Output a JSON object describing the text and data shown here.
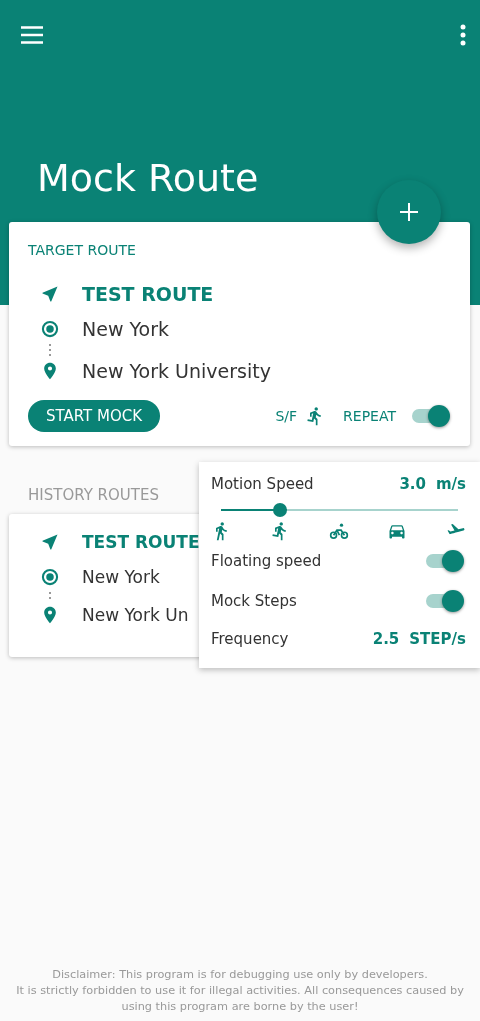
{
  "toolbar": {
    "title": "Mock Route"
  },
  "target_route": {
    "heading": "TARGET ROUTE",
    "name": "TEST ROUTE",
    "start": "New York",
    "destination": "New York University",
    "start_button": "START MOCK",
    "sf_label": "S/F",
    "repeat_label": "REPEAT",
    "repeat_on": true
  },
  "history": {
    "heading": "HISTORY ROUTES",
    "routes": [
      {
        "name": "TEST ROUTE",
        "start": "New York",
        "destination": "New York Un"
      }
    ]
  },
  "speed_panel": {
    "label": "Motion Speed",
    "value": "3.0",
    "unit": "m/s",
    "level": 0.25,
    "modes": [
      {
        "kind": "walk"
      },
      {
        "kind": "run"
      },
      {
        "kind": "bike"
      },
      {
        "kind": "car"
      },
      {
        "kind": "plane"
      }
    ],
    "settings": [
      {
        "label": "Floating speed",
        "on": true
      },
      {
        "label": "Mock Steps",
        "on": true
      }
    ],
    "frequency_label": "Frequency",
    "frequency_value": "2.5",
    "frequency_unit": "STEP/s"
  },
  "disclaimer": [
    "Disclaimer: This program is for debugging use only by developers.",
    "It is strictly forbidden to use it for illegal activities. All consequences caused by using this program are borne by the user!"
  ]
}
